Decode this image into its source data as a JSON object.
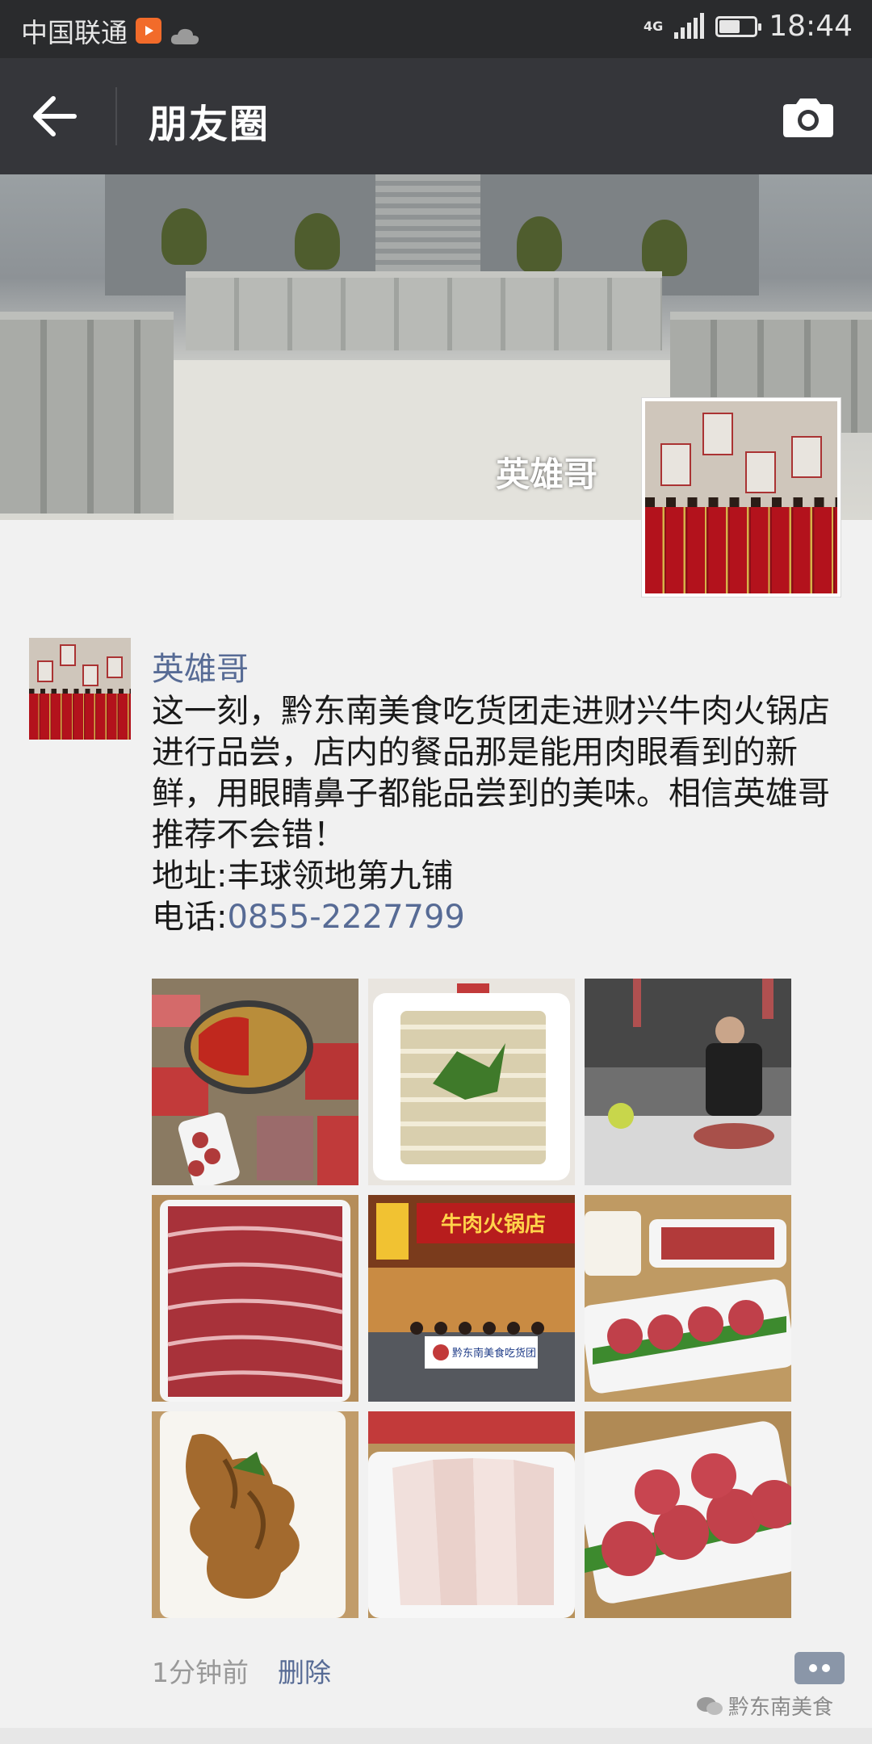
{
  "status_bar": {
    "carrier": "中国联通",
    "network": "4G",
    "time": "18:44",
    "battery_level": 0.6
  },
  "header": {
    "title": "朋友圈"
  },
  "cover": {
    "name": "英雄哥"
  },
  "post": {
    "author": "英雄哥",
    "text": "这一刻，黔东南美食吃货团走进财兴牛肉火锅店进行品尝，店内的餐品那是能用肉眼看到的新鲜，用眼睛鼻子都能品尝到的美味。相信英雄哥推荐不会错！\n地址:丰球领地第九铺\n电话:",
    "phone": "0855-2227799",
    "images": [
      {
        "label": "hotpot-spread"
      },
      {
        "label": "tripe-plate"
      },
      {
        "label": "chef-cutting-beef"
      },
      {
        "label": "sliced-beef-plate"
      },
      {
        "label": "restaurant-storefront"
      },
      {
        "label": "meatballs-table"
      },
      {
        "label": "beef-tendon-plate"
      },
      {
        "label": "sliced-fish-plate"
      },
      {
        "label": "meatballs-closeup"
      }
    ],
    "storefront_sign": "牛肉火锅店",
    "banner_text": "黔东南美食吃货团",
    "time": "1分钟前",
    "delete_label": "删除"
  },
  "watermark": {
    "text": "黔东南美食"
  },
  "colors": {
    "link": "#576b95",
    "header_bg": "#35363a",
    "status_bg": "#2a2b2d",
    "page_bg": "#f1f1f1"
  }
}
